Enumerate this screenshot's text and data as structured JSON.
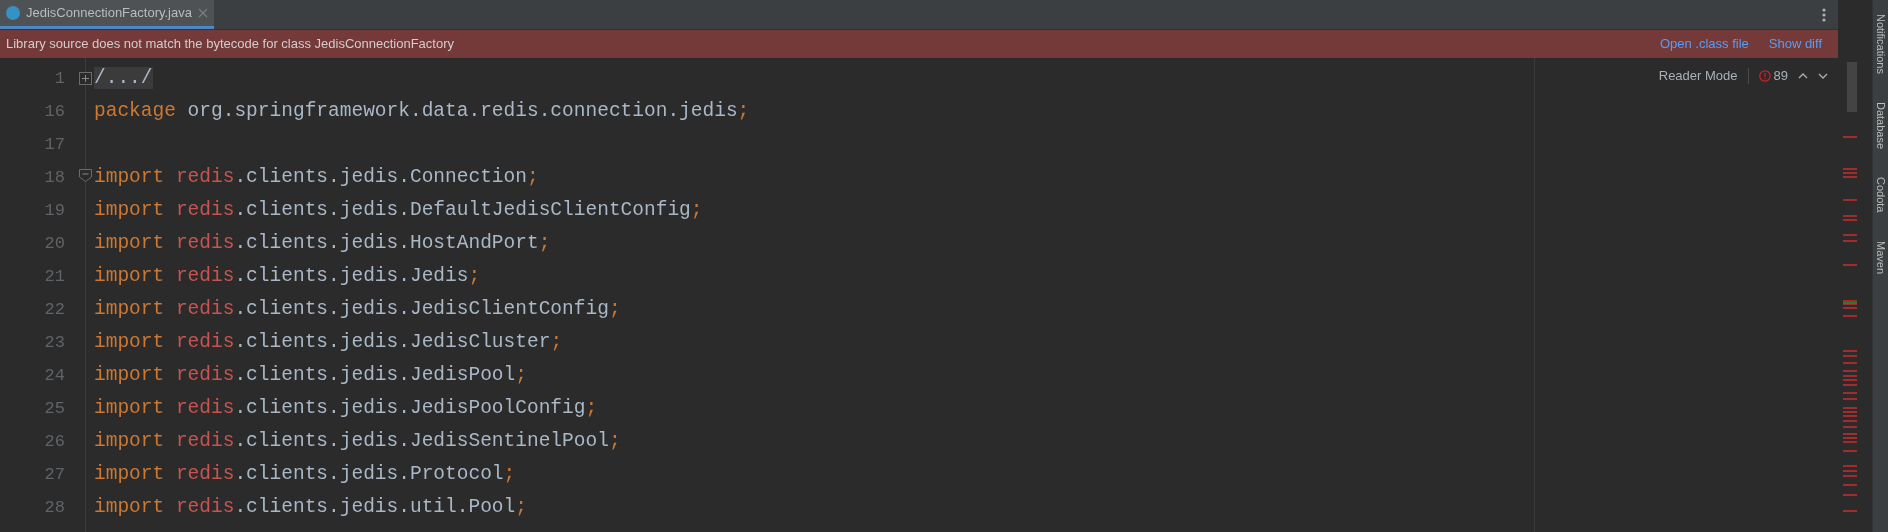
{
  "tabs": [
    {
      "label": "JedisConnectionFactory.java",
      "selected": true
    }
  ],
  "banner": {
    "message": "Library source does not match the bytecode for class JedisConnectionFactory",
    "links": [
      "Open .class file",
      "Show diff"
    ]
  },
  "editor_header": {
    "reader_mode": "Reader Mode",
    "error_count": "89"
  },
  "lines": [
    {
      "number": "1",
      "fold_marker": {
        "collapsed": true
      },
      "tokens": [
        {
          "kind": "folded",
          "text": "/.../"
        }
      ]
    },
    {
      "number": "16",
      "tokens": [
        {
          "kind": "keyword",
          "text": "package"
        },
        {
          "kind": "plain",
          "text": "org.springframework.data.redis.connection.jedis"
        },
        {
          "kind": "punct",
          "text": ";"
        }
      ]
    },
    {
      "number": "17"
    },
    {
      "number": "18",
      "fold_marker": {
        "collapsed": false
      },
      "tokens": [
        {
          "kind": "keyword",
          "text": "import"
        },
        {
          "kind": "package",
          "text": "redis"
        },
        {
          "kind": "plain",
          "text": ".clients.jedis.Connection"
        },
        {
          "kind": "punct",
          "text": ";"
        }
      ]
    },
    {
      "number": "19",
      "tokens": [
        {
          "kind": "keyword",
          "text": "import"
        },
        {
          "kind": "package",
          "text": "redis"
        },
        {
          "kind": "plain",
          "text": ".clients.jedis.DefaultJedisClientConfig"
        },
        {
          "kind": "punct",
          "text": ";"
        }
      ]
    },
    {
      "number": "20",
      "tokens": [
        {
          "kind": "keyword",
          "text": "import"
        },
        {
          "kind": "package",
          "text": "redis"
        },
        {
          "kind": "plain",
          "text": ".clients.jedis.HostAndPort"
        },
        {
          "kind": "punct",
          "text": ";"
        }
      ]
    },
    {
      "number": "21",
      "tokens": [
        {
          "kind": "keyword",
          "text": "import"
        },
        {
          "kind": "package",
          "text": "redis"
        },
        {
          "kind": "plain",
          "text": ".clients.jedis.Jedis"
        },
        {
          "kind": "punct",
          "text": ";"
        }
      ]
    },
    {
      "number": "22",
      "tokens": [
        {
          "kind": "keyword",
          "text": "import"
        },
        {
          "kind": "package",
          "text": "redis"
        },
        {
          "kind": "plain",
          "text": ".clients.jedis.JedisClientConfig"
        },
        {
          "kind": "punct",
          "text": ";"
        }
      ]
    },
    {
      "number": "23",
      "tokens": [
        {
          "kind": "keyword",
          "text": "import"
        },
        {
          "kind": "package",
          "text": "redis"
        },
        {
          "kind": "plain",
          "text": ".clients.jedis.JedisCluster"
        },
        {
          "kind": "punct",
          "text": ";"
        }
      ]
    },
    {
      "number": "24",
      "tokens": [
        {
          "kind": "keyword",
          "text": "import"
        },
        {
          "kind": "package",
          "text": "redis"
        },
        {
          "kind": "plain",
          "text": ".clients.jedis.JedisPool"
        },
        {
          "kind": "punct",
          "text": ";"
        }
      ]
    },
    {
      "number": "25",
      "tokens": [
        {
          "kind": "keyword",
          "text": "import"
        },
        {
          "kind": "package",
          "text": "redis"
        },
        {
          "kind": "plain",
          "text": ".clients.jedis.JedisPoolConfig"
        },
        {
          "kind": "punct",
          "text": ";"
        }
      ]
    },
    {
      "number": "26",
      "tokens": [
        {
          "kind": "keyword",
          "text": "import"
        },
        {
          "kind": "package",
          "text": "redis"
        },
        {
          "kind": "plain",
          "text": ".clients.jedis.JedisSentinelPool"
        },
        {
          "kind": "punct",
          "text": ";"
        }
      ]
    },
    {
      "number": "27",
      "tokens": [
        {
          "kind": "keyword",
          "text": "import"
        },
        {
          "kind": "package",
          "text": "redis"
        },
        {
          "kind": "plain",
          "text": ".clients.jedis.Protocol"
        },
        {
          "kind": "punct",
          "text": ";"
        }
      ]
    },
    {
      "number": "28",
      "tokens": [
        {
          "kind": "keyword",
          "text": "import"
        },
        {
          "kind": "package",
          "text": "redis"
        },
        {
          "kind": "plain",
          "text": ".clients.jedis.util.Pool"
        },
        {
          "kind": "punct",
          "text": ";"
        }
      ]
    }
  ],
  "tool_strip": [
    "Notifications",
    "Database",
    "Codota",
    "Maven"
  ]
}
